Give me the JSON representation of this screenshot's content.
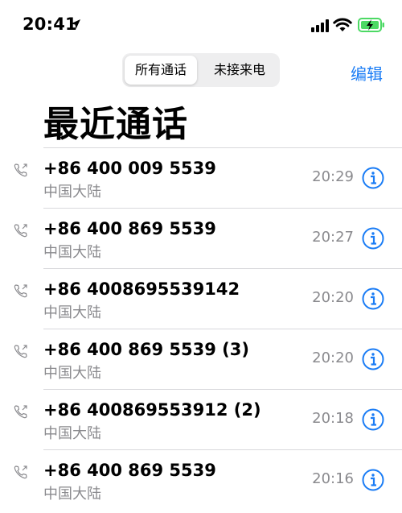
{
  "status_bar": {
    "time": "20:41"
  },
  "nav": {
    "segments": [
      "所有通话",
      "未接来电"
    ],
    "edit_label": "编辑"
  },
  "title": "最近通话",
  "calls": [
    {
      "number": "+86 400 009 5539",
      "region": "中国大陆",
      "time": "20:29"
    },
    {
      "number": "+86 400 869 5539",
      "region": "中国大陆",
      "time": "20:27"
    },
    {
      "number": "+86 4008695539142",
      "region": "中国大陆",
      "time": "20:20"
    },
    {
      "number": "+86 400 869 5539 (3)",
      "region": "中国大陆",
      "time": "20:20"
    },
    {
      "number": "+86 400869553912 (2)",
      "region": "中国大陆",
      "time": "20:18"
    },
    {
      "number": "+86 400 869 5539",
      "region": "中国大陆",
      "time": "20:16"
    }
  ],
  "colors": {
    "accent": "#1a7cf5",
    "secondary_text": "#8a8a8e",
    "battery": "#4cd964"
  },
  "icons": [
    "location-arrow-icon",
    "cellular-signal-icon",
    "wifi-icon",
    "battery-charging-icon",
    "outgoing-call-icon",
    "info-icon"
  ]
}
